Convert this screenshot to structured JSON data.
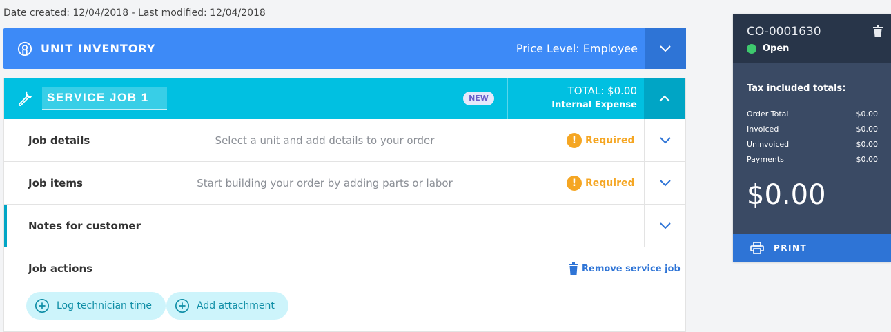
{
  "meta": {
    "dates": "Date created: 12/04/2018 - Last modified: 12/04/2018"
  },
  "unit": {
    "title": "UNIT INVENTORY",
    "price_level": "Price Level: Employee"
  },
  "job": {
    "name": "SERVICE JOB 1",
    "badge": "NEW",
    "total": "TOTAL: $0.00",
    "expense_type": "Internal Expense",
    "rows": [
      {
        "label": "Job details",
        "desc": "Select a unit and add details to your order",
        "required": "Required"
      },
      {
        "label": "Job items",
        "desc": "Start building your order by adding parts or labor",
        "required": "Required"
      },
      {
        "label": "Notes for customer"
      }
    ],
    "actions": {
      "title": "Job actions",
      "remove": "Remove service job",
      "log_time": "Log technician time",
      "add_attachment": "Add attachment"
    }
  },
  "side": {
    "order_id": "CO-0001630",
    "status": "Open",
    "tax_title": "Tax included totals:",
    "totals": [
      {
        "label": "Order Total",
        "value": "$0.00"
      },
      {
        "label": "Invoiced",
        "value": "$0.00"
      },
      {
        "label": "Uninvoiced",
        "value": "$0.00"
      },
      {
        "label": "Payments",
        "value": "$0.00"
      }
    ],
    "big_total": "$0.00",
    "print": "PRINT"
  },
  "colors": {
    "unit_bar": "#3d8af7",
    "job_header": "#01c0e1",
    "required": "#f5a623",
    "open_status": "#3ec96e",
    "side_panel": "#3a4a64",
    "print_bar": "#2e74d6"
  }
}
